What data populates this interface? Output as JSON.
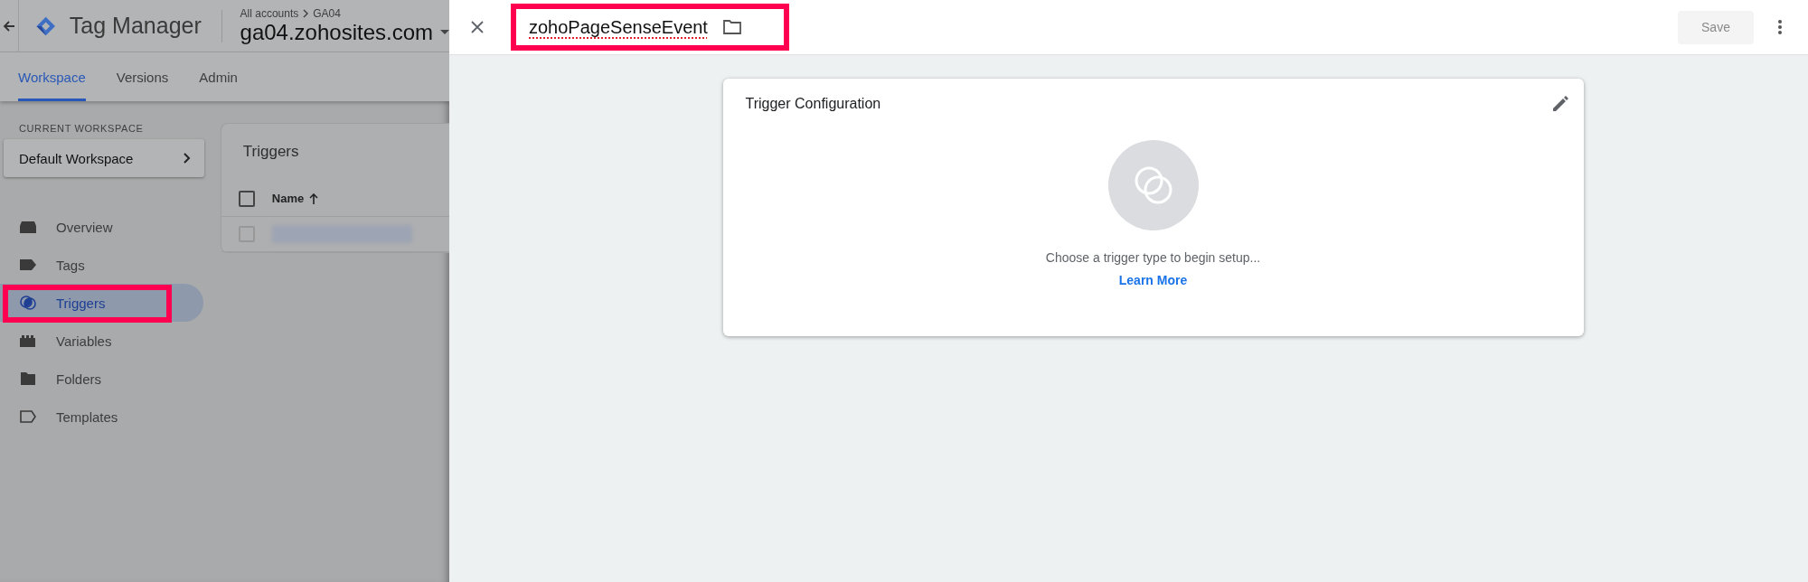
{
  "app": {
    "title": "Tag Manager"
  },
  "breadcrumb": [
    "All accounts",
    "GA04"
  ],
  "container": "ga04.zohosites.com",
  "tabs": [
    {
      "label": "Workspace",
      "selected": true
    },
    {
      "label": "Versions",
      "selected": false
    },
    {
      "label": "Admin",
      "selected": false
    }
  ],
  "workspace": {
    "label": "CURRENT WORKSPACE",
    "name": "Default Workspace"
  },
  "nav": [
    {
      "kind": "overview",
      "label": "Overview",
      "selected": false,
      "highlighted": false
    },
    {
      "kind": "tags",
      "label": "Tags",
      "selected": false,
      "highlighted": false
    },
    {
      "kind": "triggers",
      "label": "Triggers",
      "selected": true,
      "highlighted": true
    },
    {
      "kind": "variables",
      "label": "Variables",
      "selected": false,
      "highlighted": false
    },
    {
      "kind": "folders",
      "label": "Folders",
      "selected": false,
      "highlighted": false
    },
    {
      "kind": "templates",
      "label": "Templates",
      "selected": false,
      "highlighted": false
    }
  ],
  "triggers_list": {
    "title": "Triggers",
    "header": {
      "label": "Name",
      "sort_ascending": true,
      "checked": false
    },
    "rows": [
      {
        "kind": "redacted",
        "checked": false
      }
    ]
  },
  "editor": {
    "title": "zohoPageSenseEvent",
    "highlighted": true,
    "save": {
      "label": "Save",
      "disabled": true
    },
    "card": {
      "title": "Trigger Configuration",
      "hint": "Choose a trigger type to begin setup...",
      "link": "Learn More"
    }
  }
}
